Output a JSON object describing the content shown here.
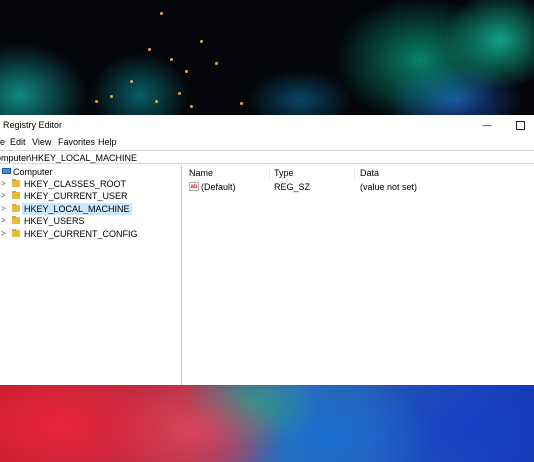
{
  "window": {
    "title": "Registry Editor",
    "minimize_glyph": "—",
    "maximize_icon": "square-icon"
  },
  "menu": {
    "items": [
      "e",
      "Edit",
      "View",
      "Favorites",
      "Help"
    ]
  },
  "address": {
    "path": "omputer\\HKEY_LOCAL_MACHINE"
  },
  "tree": {
    "root": "Computer",
    "items": [
      {
        "label": "HKEY_CLASSES_ROOT",
        "selected": false
      },
      {
        "label": "HKEY_CURRENT_USER",
        "selected": false
      },
      {
        "label": "HKEY_LOCAL_MACHINE",
        "selected": true
      },
      {
        "label": "HKEY_USERS",
        "selected": false
      },
      {
        "label": "HKEY_CURRENT_CONFIG",
        "selected": false
      }
    ],
    "chevron": ">"
  },
  "values": {
    "columns": [
      "Name",
      "Type",
      "Data"
    ],
    "rows": [
      {
        "icon": "ab",
        "name": "(Default)",
        "type": "REG_SZ",
        "data": "(value not set)"
      }
    ]
  },
  "colors": {
    "selection": "#cce8ff",
    "folder": "#e8b93a",
    "accent": "#3b8fd9"
  }
}
